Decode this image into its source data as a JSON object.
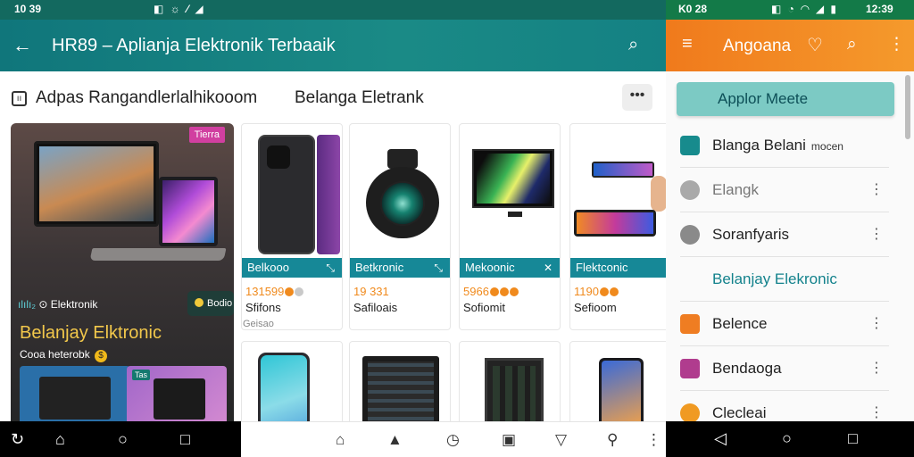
{
  "left": {
    "status": {
      "time": "10 39",
      "icons": "◧ ☼ ⁄ ◢"
    },
    "appbar": {
      "back": "←",
      "title": "HR89 – Aplianja Elektronik Terbaaik",
      "search": "⌕"
    },
    "subheader": {
      "left_text": "Adpas Rangandlerlalhikooom",
      "right_text": "Belanga Eletrank",
      "more": "•••"
    },
    "hero": {
      "badge": "Tierra",
      "brandline": "Elektronik",
      "chip": "Bodio",
      "title": "Belanjay Elktronic",
      "subtitle": "Cooa heterobk",
      "mini_pill": "Tas"
    },
    "cards": [
      {
        "tag": "Belkooo",
        "price": "131599",
        "name": "Sfifons",
        "dots": [
          "#f08a1d",
          "#c9c9c9"
        ]
      },
      {
        "tag": "Betkronic",
        "price": "19 331",
        "name": "Safiloais",
        "dots": []
      },
      {
        "tag": "Mekoonic",
        "price": "5966",
        "name": "Sofiomit",
        "dots": [
          "#f08a1d",
          "#f08a1d",
          "#f08a1d"
        ]
      },
      {
        "tag": "Flektconic",
        "price": "1190",
        "name": "Sefioom",
        "dots": [
          "#f08a1d",
          "#f08a1d"
        ]
      }
    ],
    "note": "Geisao",
    "nav_left": [
      "↻",
      "⌂",
      "○",
      "□"
    ],
    "nav_right": [
      "⌂",
      "▲",
      "◷",
      "▣",
      "▽",
      "⚲",
      "⋮"
    ]
  },
  "right": {
    "status": {
      "time": "K0 28",
      "icons": "◧ ◔ ◠ ◢ ▮",
      "clock": "12:39"
    },
    "appbar": {
      "menu": "≡",
      "title": "Angoana",
      "heart": "♡",
      "search": "⌕",
      "more": "⋮"
    },
    "action_button": "Applor Meete",
    "items": [
      {
        "label": "Blanga Belani",
        "sub": "mocen",
        "color": "#178b8d",
        "more": ""
      },
      {
        "label": "Elangk",
        "sub": "",
        "color": "#a9a9a9",
        "more": "⋮"
      },
      {
        "label": "Soranfyaris",
        "sub": "",
        "color": "#8a8a8a",
        "more": "⋮"
      },
      {
        "label": "Belanjay Elekronic",
        "sub": "",
        "color": "",
        "more": "",
        "section": true
      },
      {
        "label": "Belence",
        "sub": "",
        "color": "#ef7d22",
        "more": "⋮"
      },
      {
        "label": "Bendaoga",
        "sub": "",
        "color": "#b03c8e",
        "more": "⋮"
      },
      {
        "label": "Clecleai",
        "sub": "",
        "color": "#f09a22",
        "more": "⋮"
      }
    ],
    "nav": [
      "◁",
      "○",
      "□"
    ]
  }
}
